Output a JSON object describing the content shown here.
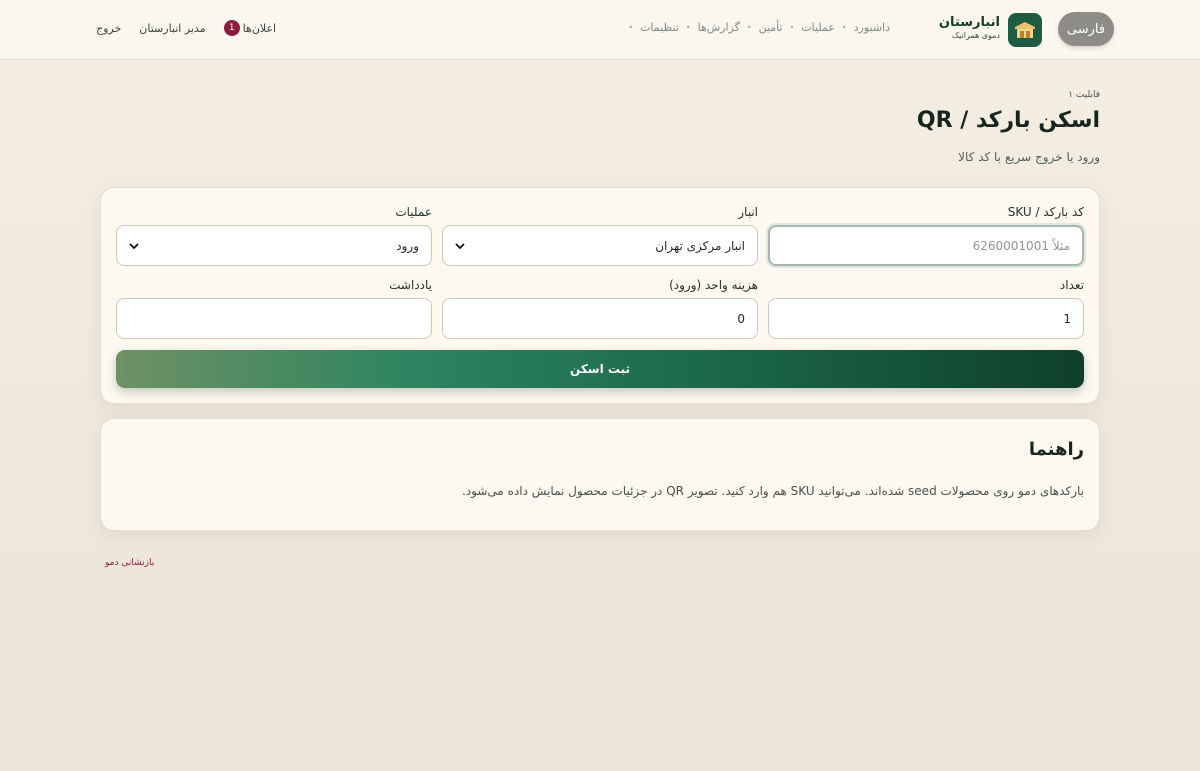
{
  "header": {
    "lang_button": "فارسی",
    "brand_name": "انبارستان",
    "brand_sub": "دموی همراتیک",
    "nav": [
      {
        "label": "داشبورد"
      },
      {
        "label": "عملیات"
      },
      {
        "label": "تأمین"
      },
      {
        "label": "گزارش‌ها"
      },
      {
        "label": "تنظیمات"
      }
    ],
    "notifications_label": "اعلان‌ها",
    "notifications_count": "1",
    "user_name": "مدیر انبارستان",
    "logout_label": "خروج"
  },
  "page": {
    "eyebrow": "قابلیت ۱",
    "title": "اسکن بارکد / QR",
    "subtitle": "ورود یا خروج سریع با کد کالا"
  },
  "form": {
    "barcode": {
      "label": "کد بارکد / SKU",
      "placeholder": "مثلاً 6260001001",
      "value": ""
    },
    "warehouse": {
      "label": "انبار",
      "value": "انبار مرکزی تهران"
    },
    "operation": {
      "label": "عملیات",
      "value": "ورود"
    },
    "quantity": {
      "label": "تعداد",
      "value": "1"
    },
    "unit_cost": {
      "label": "هزینه واحد (ورود)",
      "value": "0"
    },
    "note": {
      "label": "یادداشت",
      "value": ""
    },
    "submit_label": "ثبت اسکن"
  },
  "guide": {
    "title": "راهنما",
    "text": "بارکدهای دمو روی محصولات seed شده‌اند. می‌توانید SKU هم وارد کنید. تصویر QR در جزئیات محصول نمایش داده می‌شود."
  },
  "footer": {
    "reset_label": "بازنشانی دمو"
  },
  "colors": {
    "brand": "#1d5c41",
    "badge": "#8c1c3a",
    "accent_dark": "#0f3f2c"
  }
}
